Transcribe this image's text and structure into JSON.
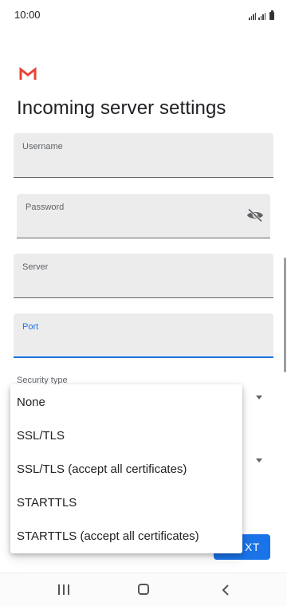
{
  "status_bar": {
    "time": "10:00"
  },
  "icons": {
    "logo": "gmail-logo",
    "password_toggle": "visibility-off-icon",
    "nav_recent": "recent-apps-icon",
    "nav_home": "home-icon",
    "nav_back": "back-icon"
  },
  "colors": {
    "accent": "#1a73e8",
    "gmail_red": "#ea4335",
    "field_bg": "#ececec"
  },
  "page": {
    "title": "Incoming server settings"
  },
  "form": {
    "username": {
      "label": "Username",
      "value": ""
    },
    "password": {
      "label": "Password",
      "value": ""
    },
    "server": {
      "label": "Server",
      "value": ""
    },
    "port": {
      "label": "Port",
      "value": ""
    },
    "security_type": {
      "label": "Security type"
    }
  },
  "dropdown": {
    "options": [
      "None",
      "SSL/TLS",
      "SSL/TLS (accept all certificates)",
      "STARTTLS",
      "STARTTLS (accept all certificates)"
    ]
  },
  "buttons": {
    "next_visible_text": "XT"
  }
}
